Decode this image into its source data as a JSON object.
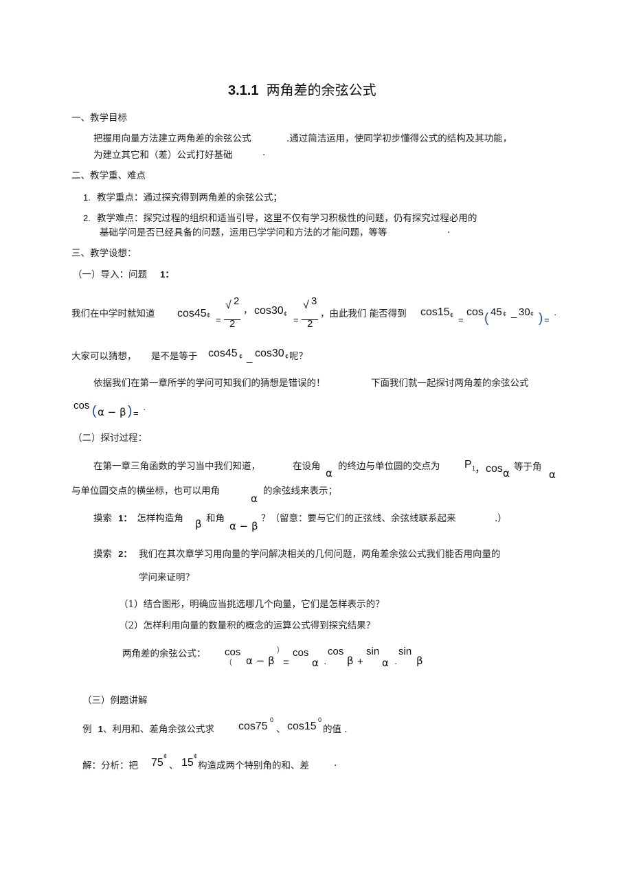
{
  "title": {
    "number": "3.1.1",
    "text": "两角差的余弦公式"
  },
  "section1": {
    "heading": "一、教学目标",
    "line1a": "把握用向量方法建立两角差的余弦公式",
    "line1b": ".通过简洁运用，使同学初步懂得公式的结构及其功能，",
    "line2a": "为建立其它和（差）公式打好基础",
    "line2b": "."
  },
  "section2": {
    "heading": "二、教学重、难点",
    "items": [
      {
        "num": "1.",
        "text": "教学重点：通过探究得到两角差的余弦公式；"
      },
      {
        "num": "2.",
        "text": "教学难点：探究过程的组织和适当引导，这里不仅有学习积极性的问题，仍有探究过程必用的",
        "cont": "基础学问是否已经具备的问题，运用已学学问和方法的才能问题，等等",
        "end": "."
      }
    ]
  },
  "section3": {
    "heading": "三、教学设想：",
    "part1": {
      "heading": "（一）导入：问题",
      "heading_num": "1：",
      "intro": "我们在中学时就知道",
      "cos45": "cos45",
      "deg_mark": "¢",
      "eq": "=",
      "sqrt": "√",
      "num2": "2",
      "den2": "2",
      "comma": "，",
      "cos30": "cos30",
      "num3": "3",
      "den3": "2",
      "mid_text": "，由此我们  能否得到",
      "cos15": "cos15",
      "cos": "cos",
      "lparen": "(",
      "a45": "45",
      "minus": "_",
      "a30": "30",
      "rparen": ")",
      "tail": "=",
      "dot": "·",
      "guess_text": "大家可以猜想，",
      "guess_text2": "是不是等于",
      "guess_cos45": "cos45",
      "guess_minus": "_",
      "guess_cos30": "cos30",
      "guess_end": "呢？",
      "according": "依据我们在第一章所学的学问可知我们的猜想是错误的！",
      "below": "下面我们就一起探讨两角差的余弦公式",
      "formula_cos": "cos",
      "formula_body": "α − β",
      "formula_end": ")=",
      "formula_dot": "·"
    },
    "part2": {
      "heading": "（二）探讨过程：",
      "p1a": "在第一章三角函数的学习当中我们知道，",
      "p1b": "在设角",
      "alpha": "α",
      "p1c": "的终边与单位圆的交点为",
      "P": "P",
      "P_sub": "1",
      "p1d": "，cos",
      "p1e": "等于角",
      "p2a": "与单位圆交点的横坐标，也可以用角",
      "p2b": "的余弦线来表示；",
      "explore1_label": "摸索",
      "explore1_num": "1：",
      "explore1_a": "怎样构造角",
      "beta": "β",
      "explore1_b": "和角",
      "alpha_minus_beta": "α − β",
      "explore1_c": "？（留意：要与它们的正弦线、余弦线联系起来",
      "explore1_end": ".）",
      "explore2_label": "摸索",
      "explore2_num": "2：",
      "explore2_a": "我们在其次章学习用向量的学问解决相关的几何问题，两角差余弦公式我们能否用向量的",
      "explore2_b": "学问来证明？",
      "q1": "（1）结合图形，明确应当挑选哪几个向量，它们是怎样表示的？",
      "q2": "（2）怎样利用向量的数量积的概念的运算公式得到探究结果？",
      "formula_label": "两角差的余弦公式：",
      "f_cos": "cos",
      "f_lparen": "(",
      "f_rparen": ")",
      "f_amb": "α − β",
      "f_eq": "=",
      "f_cos2": "cos",
      "f_alpha": "α",
      "f_dot": "·",
      "f_cos3": "cos",
      "f_beta": "β",
      "f_plus": "+",
      "f_sin": "sin",
      "f_sin2": "sin"
    },
    "part3": {
      "heading": "（三）例题讲解",
      "ex1_a": "例",
      "ex1_num": "1",
      "ex1_b": "、利用和、差角余弦公式求",
      "ex1_cos75": "cos75",
      "ex1_sup": "0",
      "ex1_sep": "、",
      "ex1_cos15": "cos15",
      "ex1_end": "的值 .",
      "sol_a": "解：分析：把",
      "sol_75": "75",
      "sol_sup": "¢",
      "sol_sep": "、",
      "sol_15": "15",
      "sol_b": "构造成两个特别角的和、差",
      "sol_end": "."
    }
  }
}
